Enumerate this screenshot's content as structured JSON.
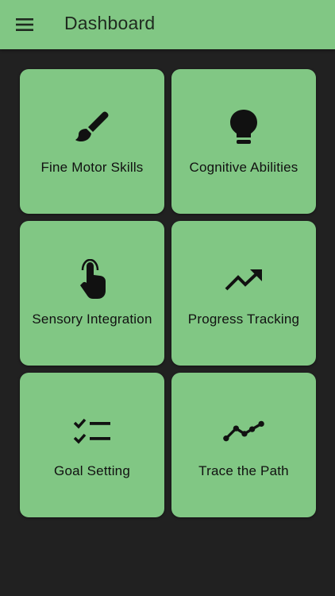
{
  "appbar": {
    "title": "Dashboard",
    "menu_icon": "menu-icon",
    "color": "#81C784"
  },
  "background": "#212121",
  "cards": [
    {
      "label": "Fine Motor Skills",
      "icon": "paintbrush-icon"
    },
    {
      "label": "Cognitive Abilities",
      "icon": "lightbulb-icon"
    },
    {
      "label": "Sensory Integration",
      "icon": "touch-hand-icon"
    },
    {
      "label": "Progress Tracking",
      "icon": "trending-up-icon"
    },
    {
      "label": "Goal Setting",
      "icon": "checklist-icon"
    },
    {
      "label": "Trace the Path",
      "icon": "line-path-icon"
    }
  ]
}
